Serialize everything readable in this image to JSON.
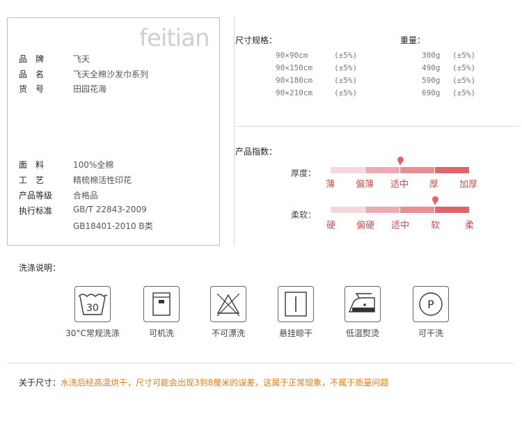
{
  "product": {
    "logo_text": "feitian",
    "fields": [
      {
        "label": "品　牌",
        "value": "飞天"
      },
      {
        "label": "品　名",
        "value": "飞天全棉沙发巾系列"
      },
      {
        "label": "货　号",
        "value": "田园花海"
      },
      {
        "label": "面　料",
        "value": "100%全棉"
      },
      {
        "label": "工　艺",
        "value": "精梳棉活性印花"
      },
      {
        "label": "产品等级",
        "value": "合格品"
      },
      {
        "label": "执行标准",
        "value": "GB/T 22843-2009"
      }
    ],
    "standard_line2": "GB18401-2010 B类"
  },
  "specs": {
    "size_title": "尺寸规格：",
    "weight_title": "重量：",
    "rows": [
      {
        "size": "90×90cm",
        "size_tol": "(±5%)",
        "weight": "300g",
        "weight_tol": "(±5%)"
      },
      {
        "size": "90×150cm",
        "size_tol": "(±5%)",
        "weight": "490g",
        "weight_tol": "(±5%)"
      },
      {
        "size": "90×180cm",
        "size_tol": "(±5%)",
        "weight": "590g",
        "weight_tol": "(±5%)"
      },
      {
        "size": "90×210cm",
        "size_tol": "(±5%)",
        "weight": "690g",
        "weight_tol": "(±5%)"
      }
    ]
  },
  "index": {
    "title": "产品指数：",
    "scales": [
      {
        "label": "厚度：",
        "words": [
          "薄",
          "偏薄",
          "适中",
          "厚",
          "加厚"
        ],
        "level": 0.5
      },
      {
        "label": "柔软：",
        "words": [
          "硬",
          "偏硬",
          "适中",
          "软",
          "柔"
        ],
        "level": 0.75
      }
    ],
    "colors": [
      "#f6d8dc",
      "#eeaab2",
      "#e88e95",
      "#e0646c"
    ]
  },
  "wash": {
    "title": "洗涤说明：",
    "items": [
      {
        "label": "30°C常规洗涤",
        "icon": "wash-30-icon",
        "glyph": "30"
      },
      {
        "label": "可机洗",
        "icon": "machine-wash-icon"
      },
      {
        "label": "不可漂洗",
        "icon": "no-bleach-icon"
      },
      {
        "label": "悬挂晾干",
        "icon": "hang-dry-icon"
      },
      {
        "label": "低温熨烫",
        "icon": "low-iron-icon"
      },
      {
        "label": "可干洗",
        "icon": "dry-clean-icon",
        "glyph": "P"
      }
    ]
  },
  "note": {
    "label": "关于尺寸：",
    "text": "水洗后经高温烘干，尺寸可能会出现3到8厘米的误差，这属于正常现象，不属于质量问题"
  }
}
